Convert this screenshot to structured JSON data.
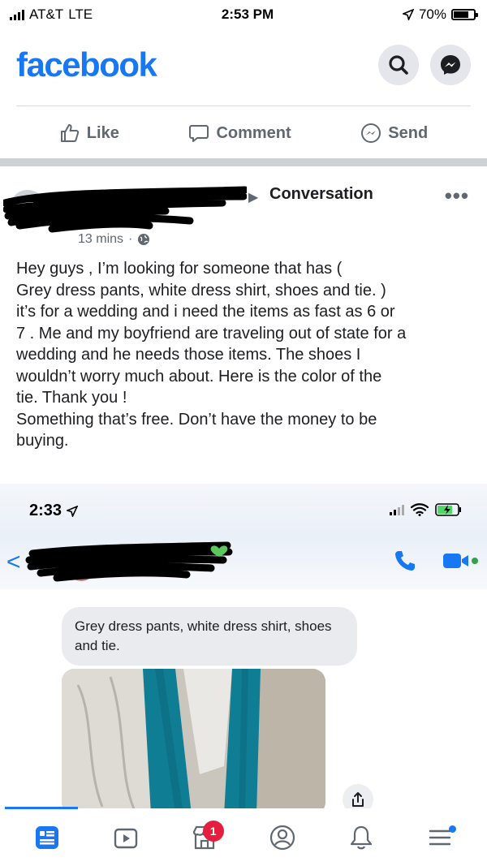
{
  "status_bar": {
    "carrier": "AT&T",
    "network": "LTE",
    "time": "2:53 PM",
    "battery": "70%",
    "battery_fraction": 0.7
  },
  "header": {
    "logo": "facebook",
    "icons": [
      "search-icon",
      "messenger-icon"
    ]
  },
  "actions": {
    "like": "Like",
    "comment": "Comment",
    "send": "Send"
  },
  "post": {
    "group": "Conversation",
    "timestamp": "13 mins",
    "privacy_icon": "globe-icon",
    "text": "Hey guys , I’m looking for someone that has (\nGrey dress pants, white dress shirt, shoes and tie. )\nit’s for a wedding and i need the items as fast as 6 or\n7 . Me and my boyfriend are traveling out of state for a\nwedding and he needs those items. The shoes I\nwouldn’t worry much about. Here is the color of the\ntie. Thank you !\nSomething that’s free. Don’t have the money to be\nbuying."
  },
  "embedded": {
    "time": "2:33",
    "message": "Grey dress pants, white dress shirt, shoes and tie."
  },
  "nav": {
    "items": [
      "news-feed-icon",
      "watch-icon",
      "marketplace-icon",
      "profile-icon",
      "notifications-icon",
      "menu-icon"
    ],
    "marketplace_badge": "1"
  },
  "colors": {
    "brand": "#1877f2",
    "badge": "#e41e3f",
    "tie": "#0f7e95"
  }
}
